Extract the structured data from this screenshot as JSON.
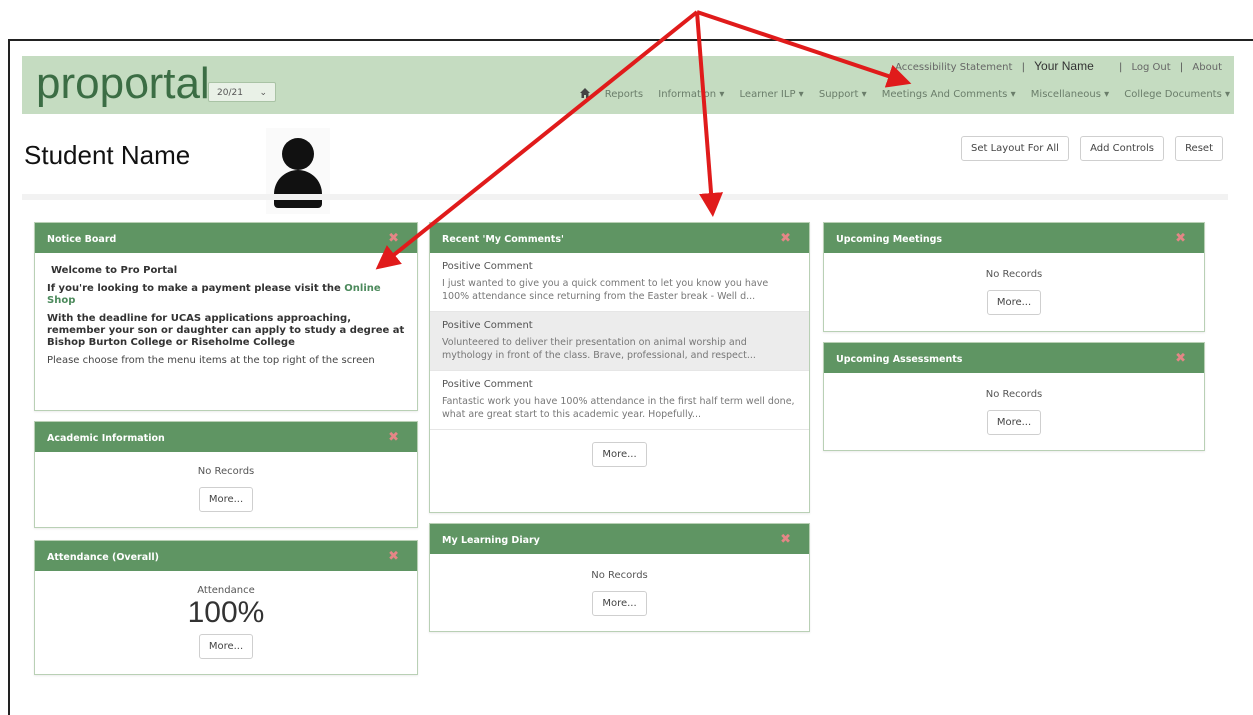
{
  "app": {
    "logo_text_a": "prop",
    "logo_text_o": "o",
    "logo_text_b": "rtal",
    "year_select": "20/21",
    "toplinks": {
      "accessibility": "Accessibility Statement",
      "your_name": "Your Name",
      "log_out": "Log Out",
      "about": "About"
    },
    "nav": [
      {
        "label": "Reports"
      },
      {
        "label": "Information ▾"
      },
      {
        "label": "Learner ILP ▾"
      },
      {
        "label": "Support ▾"
      },
      {
        "label": "Meetings And Comments ▾"
      },
      {
        "label": "Miscellaneous ▾"
      },
      {
        "label": "College Documents ▾"
      }
    ],
    "home_icon": "home-icon"
  },
  "page": {
    "title": "Student Name",
    "buttons": {
      "set_layout": "Set Layout For All",
      "add_controls": "Add Controls",
      "reset": "Reset"
    }
  },
  "panels": {
    "notice_board": {
      "title": "Notice Board",
      "welcome": "Welcome to Pro Portal",
      "payment_text": "If you're looking to make a payment please visit the ",
      "payment_link": "Online Shop",
      "ucas_text": "With the deadline for UCAS applications approaching, remember your son or daughter can apply to study a degree at Bishop Burton College or Riseholme College",
      "choose_text": "Please choose from the menu items at the top right of the screen"
    },
    "academic": {
      "title": "Academic Information",
      "no_records": "No Records",
      "more": "More..."
    },
    "attendance": {
      "title": "Attendance (Overall)",
      "label": "Attendance",
      "value": "100%",
      "more": "More..."
    },
    "comments": {
      "title": "Recent 'My Comments'",
      "items": [
        {
          "title": "Positive Comment",
          "text": "I just wanted to give you a quick comment to let you know you have 100% attendance since returning from the Easter break - Well d..."
        },
        {
          "title": "Positive Comment",
          "text": "Volunteered to deliver their presentation on animal worship and mythology in front of the class. Brave, professional, and respect..."
        },
        {
          "title": "Positive Comment",
          "text": "Fantastic work you have 100% attendance in the first half term well done, what are great start to this academic year. Hopefully..."
        }
      ],
      "more": "More..."
    },
    "diary": {
      "title": "My Learning Diary",
      "no_records": "No Records",
      "more": "More..."
    },
    "meetings": {
      "title": "Upcoming Meetings",
      "no_records": "No Records",
      "more": "More..."
    },
    "assessments": {
      "title": "Upcoming Assessments",
      "no_records": "No Records",
      "more": "More..."
    },
    "close_icon": "close-icon"
  },
  "colors": {
    "header_bg": "#c5dcc1",
    "panel_head": "#5f9563",
    "arrow": "#e01b1b",
    "close_x": "#e48686"
  }
}
